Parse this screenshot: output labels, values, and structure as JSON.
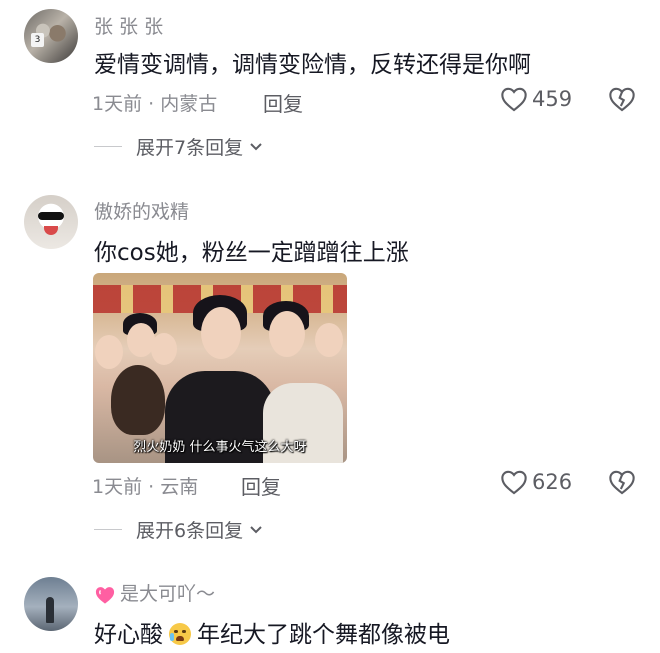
{
  "comments": [
    {
      "username": "张 张 张",
      "avatar_tag": "3",
      "text": "爱情变调情，调情变险情，反转还得是你啊",
      "time_location": "1天前 · 内蒙古",
      "reply_label": "回复",
      "likes": "459",
      "expand_label": "展开7条回复"
    },
    {
      "username": "傲娇的戏精",
      "text": "你cos她，粉丝一定蹭蹭往上涨",
      "image_subtitle": "烈火奶奶  什么事火气这么大呀",
      "time_location": "1天前 · 云南",
      "reply_label": "回复",
      "likes": "626",
      "expand_label": "展开6条回复"
    },
    {
      "username": "是大可吖～",
      "text_part1": "好心酸",
      "text_part2": "年纪大了跳个舞都像被电"
    }
  ],
  "colors": {
    "meta": "#8a8b91",
    "text": "#161823",
    "accent_heart": "#ff5fa2"
  },
  "icons": [
    "heart-outline-icon",
    "broken-heart-icon",
    "chevron-down-icon",
    "pink-heart-emoji-icon",
    "crying-face-emoji-icon"
  ]
}
